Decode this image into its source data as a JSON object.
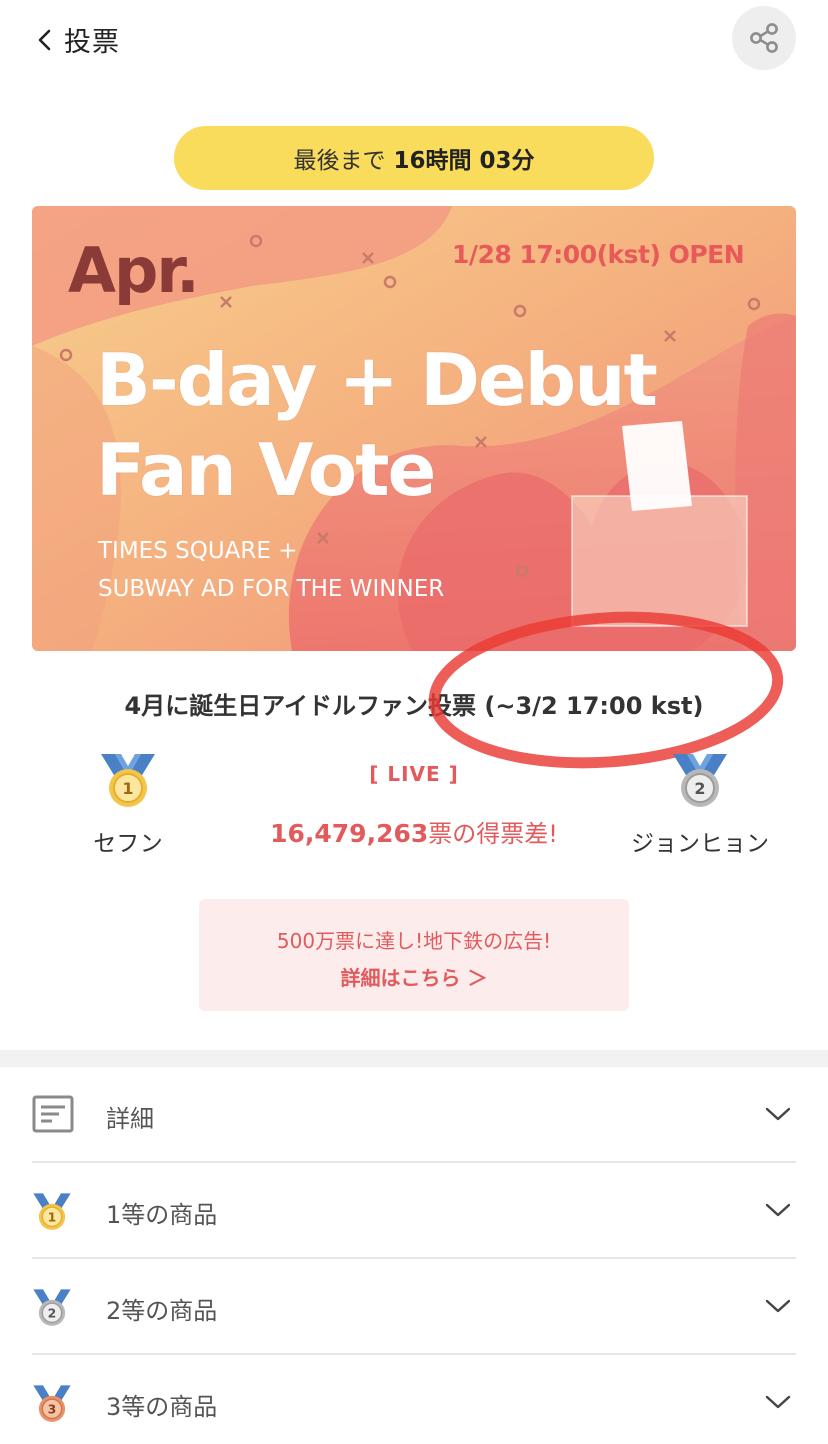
{
  "header": {
    "back_label": "投票"
  },
  "countdown": {
    "prefix": "最後まで",
    "time": "16時間 03分"
  },
  "banner": {
    "month": "Apr.",
    "open_text": "1/28 17:00(kst) OPEN",
    "title_line1": "B-day + Debut",
    "title_line2": "Fan Vote",
    "sub_line1": "TIMES SQUARE +",
    "sub_line2": "SUBWAY AD FOR THE WINNER"
  },
  "vote": {
    "title": "4月に誕生日アイドルファン投票 (~3/2 17:00 kst)",
    "live_label": "[ LIVE ]",
    "diff_number": "16,479,263",
    "diff_suffix": "票の得票差!",
    "rank1": {
      "medal": "1",
      "name": "セフン"
    },
    "rank2": {
      "medal": "2",
      "name": "ジョンヒョン"
    }
  },
  "notice": {
    "line1": "500万票に達し!地下鉄の広告!",
    "line2": "詳細はこちら ＞"
  },
  "accordion": [
    {
      "label": "詳細",
      "icon": "document-icon"
    },
    {
      "label": "1等の商品",
      "icon": "gold-medal-icon",
      "medal": "1"
    },
    {
      "label": "2等の商品",
      "icon": "silver-medal-icon",
      "medal": "2"
    },
    {
      "label": "3等の商品",
      "icon": "bronze-medal-icon",
      "medal": "3"
    }
  ],
  "colors": {
    "accent_red": "#e25a5c",
    "countdown_yellow": "#f9dc5c",
    "notice_bg": "#fcecec"
  }
}
